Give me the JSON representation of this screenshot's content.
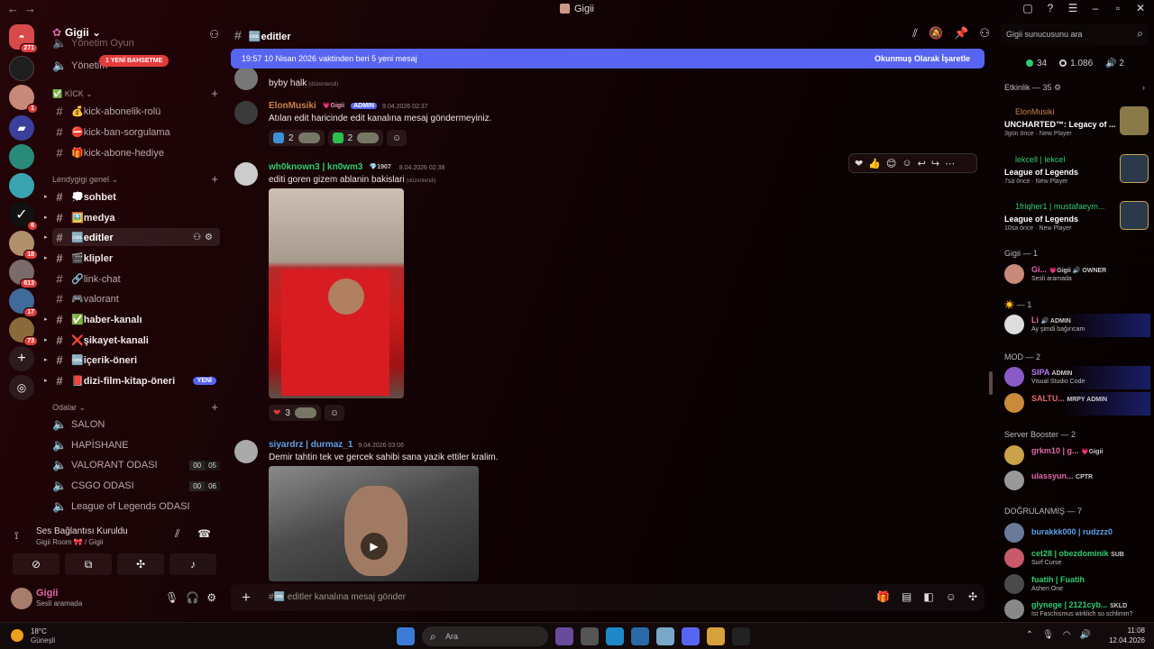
{
  "window": {
    "title": "Gigii"
  },
  "guild": {
    "name": "Gigii",
    "mention_pill": "1 YENİ BAHSETME"
  },
  "servers": [
    {
      "badge": "271"
    },
    {
      "badge": ""
    },
    {
      "badge": "1"
    },
    {
      "badge": ""
    },
    {
      "badge": ""
    },
    {
      "badge": ""
    },
    {
      "badge": "6"
    },
    {
      "badge": "18"
    },
    {
      "badge": "613"
    },
    {
      "badge": "17"
    },
    {
      "badge": "73"
    }
  ],
  "channels": {
    "top_partial": "Yönetim Oyun",
    "yonetim": "Yönetim",
    "cat_kick": "KİCK",
    "kick": [
      "💰kick-abonelik-rolü",
      "⛔kick-ban-sorgulama",
      "🎁kick-abone-hediye"
    ],
    "cat_genel": "Lendygigi genel",
    "genel": [
      {
        "label": "💭sohbet",
        "bold": true
      },
      {
        "label": "🖼️medya",
        "bold": true
      },
      {
        "label": "🆒editler",
        "bold": true,
        "selected": true
      },
      {
        "label": "🎬klipler",
        "bold": true
      },
      {
        "label": "🔗link-chat",
        "bold": false
      },
      {
        "label": "🎮valorant",
        "bold": false
      },
      {
        "label": "✅haber-kanalı",
        "bold": true
      },
      {
        "label": "❌şikayet-kanali",
        "bold": true
      },
      {
        "label": "🆒içerik-öneri",
        "bold": true
      },
      {
        "label": "📕dizi-film-kitap-öneri",
        "bold": true,
        "tag": "YENİ"
      }
    ],
    "cat_odalar": "Odalar",
    "voice": [
      {
        "label": "SALON"
      },
      {
        "label": "HAPİSHANE"
      },
      {
        "label": "VALORANT ODASI",
        "counts": [
          "00",
          "05"
        ]
      },
      {
        "label": "CSGO ODASI",
        "counts": [
          "00",
          "06"
        ]
      },
      {
        "label": "League of Legends ODASI"
      }
    ]
  },
  "voice_panel": {
    "status": "Ses Bağlantısı Kuruldu",
    "room": "Gigii Room 🎀 / Gigii"
  },
  "user": {
    "name": "Gigii",
    "status": "Sesli aramada"
  },
  "header": {
    "channel": "🆒editler"
  },
  "banner": {
    "text": "19:57 10 Nisan 2026 vaktinden beri 5 yeni mesaj",
    "action": "Okunmuş Olarak İşaretle"
  },
  "messages": [
    {
      "text": "byby halk",
      "edited": "(düzenlendi)"
    },
    {
      "author": "ElonMusiki",
      "tags": [
        "💗Gigii",
        "ADMIN"
      ],
      "time": "9.04.2026 02:37",
      "text": "Atılan edit haricinde edit kanalına mesaj göndermeyiniz.",
      "reactions": [
        {
          "count": "2"
        },
        {
          "count": "2"
        }
      ]
    },
    {
      "author": "wh0known3 | kn0wm3",
      "tags": [
        "💎1907"
      ],
      "time": "9.04.2026 02:38",
      "text": "editi goren gizem ablanin bakislari",
      "edited": "(düzenlendi)",
      "reactions": [
        {
          "count": "3"
        }
      ]
    },
    {
      "author": "siyardrz | durmaz_1",
      "time": "9.04.2026 03:06",
      "text": "Demir tahtin tek ve gercek sahibi sana yazik ettiler kralim."
    }
  ],
  "composer": {
    "placeholder": "#🆒 editler kanalına mesaj gönder"
  },
  "members": {
    "search_placeholder": "Gigii sunucusunu ara",
    "stats": [
      "34",
      "1.086",
      "2"
    ],
    "activity_header": "Etkinlik — 35",
    "activities": [
      {
        "name": "ElonMusiki",
        "game": "UNCHARTED™: Legacy of ...",
        "meta": "3gün önce · New Player"
      },
      {
        "name": "lekcell | lekcel",
        "game": "League of Legends",
        "meta": "7sa önce · New Player"
      },
      {
        "name": "1friqher1 | mustafaeym...",
        "game": "League of Legends",
        "meta": "10sa önce · New Player"
      }
    ],
    "groups": [
      {
        "title": "Gigii — 1",
        "members": [
          {
            "name": "Gi...",
            "tags": "💗Gigii 🔊 OWNER",
            "status": "Sesli aramada"
          }
        ]
      },
      {
        "title": "☀️ — 1",
        "members": [
          {
            "name": "Li",
            "tags": "🔊 ADMIN",
            "status": "Ay şimdi bağırıcam"
          }
        ]
      },
      {
        "title": "MOD — 2",
        "members": [
          {
            "name": "SIPA",
            "tags": "ADMIN",
            "status": "Visual Studio Code"
          },
          {
            "name": "SALTU...",
            "tags": "MRPY ADMIN",
            "status": ""
          }
        ]
      },
      {
        "title": "Server Booster — 2",
        "members": [
          {
            "name": "grkm10 | g...",
            "tags": "💗Gigii",
            "status": ""
          },
          {
            "name": "ulassyun...",
            "tags": "CPTR",
            "status": ""
          }
        ]
      },
      {
        "title": "DOĞRULANMIŞ — 7",
        "members": [
          {
            "name": "burakkk000 | rudzzz0",
            "tags": "",
            "status": ""
          },
          {
            "name": "cet28 | obezdominik",
            "tags": "SUB",
            "status": "Surf Curse"
          },
          {
            "name": "fuatih | Fuatih",
            "tags": "",
            "status": "Ashen One"
          },
          {
            "name": "glynege | 2121cyb...",
            "tags": "SKLD",
            "status": "Ist Faschismus wirklich so schlimm?"
          }
        ]
      }
    ]
  },
  "taskbar": {
    "temp": "18°C",
    "weather": "Güneşli",
    "search": "Ara",
    "time": "11:08",
    "date": "12.04.2026"
  },
  "colors": {
    "accent": "#5865f2",
    "admin": "#5865f2",
    "online": "#2ecc71",
    "mention": "#e23b3b"
  }
}
